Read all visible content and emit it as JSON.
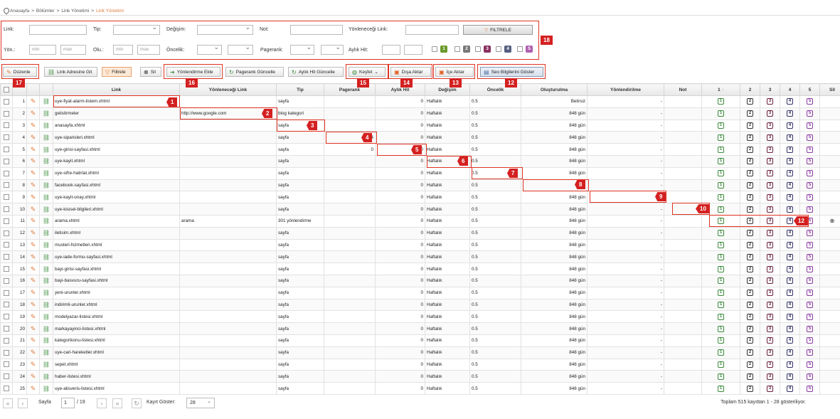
{
  "breadcrumb": {
    "items": [
      "Anasayfa",
      "Bölümler",
      "Link Yönetimi"
    ],
    "current": "Link Yönetimi",
    "separator": ">"
  },
  "filter": {
    "link_label": "Link:",
    "tip_label": "Tip:",
    "degisim_label": "Değişim:",
    "not_label": "Not:",
    "yonlenecegi_label": "Yönleneceği Link:",
    "filter_button": "FILTRELE",
    "yon_label": "Yön.:",
    "olu_label": "Olu.:",
    "oncelik_label": "Öncelik:",
    "pagerank_label": "Pagerank:",
    "aylik_label": "Aylık Hit:",
    "min_placeholder": "min",
    "max_placeholder": "max",
    "levels": [
      "1",
      "2",
      "3",
      "4",
      "5"
    ],
    "level_colors": [
      "#6a9a2a",
      "#777777",
      "#8a3060",
      "#556080",
      "#b060b0"
    ]
  },
  "toolbar": {
    "duzenle": "Düzenle",
    "link_adresine_git": "Link Adresine Git",
    "filtrele": "Filtrele",
    "sil": "Sil",
    "yonlendirme_ekle": "Yönlendirme Ekle",
    "pagerank_guncelle": "Pagerank Güncelle",
    "aylik_hit_guncelle": "Aylık Hit Güncelle",
    "kesfet": "Keşfet",
    "disa_aktar": "Dışa Aktar",
    "ice_aktar": "İçe Aktar",
    "seo_bilgileri": "Seo Bilgilerini Göster"
  },
  "annotations": [
    "1",
    "2",
    "3",
    "4",
    "5",
    "6",
    "7",
    "8",
    "9",
    "10",
    "11",
    "12",
    "13",
    "14",
    "15",
    "16",
    "17",
    "18"
  ],
  "table": {
    "headers": [
      "Link",
      "Yönleneceği Link",
      "Tip",
      "Pagerank",
      "Aylık Hit",
      "Değişim",
      "Öncelik",
      "Oluşturulma",
      "Yönlendirilme",
      "Not",
      "1",
      "2",
      "3",
      "4",
      "5",
      "Sil"
    ],
    "level_colors": [
      "#3a8a3a",
      "#333333",
      "#6a2040",
      "#333366",
      "#8a3aa0"
    ],
    "rows": [
      {
        "n": "1",
        "link": "uye-fiyat-alarm-listem.xhtml",
        "hedef": "",
        "tip": "sayfa",
        "pr": "",
        "hit": "0",
        "degisim": "Haftalık",
        "oncelik": "0.5",
        "olus": "Belirsiz",
        "yon": "-"
      },
      {
        "n": "2",
        "link": "gelistirmeler",
        "hedef": "http://www.google.com",
        "tip": "blog kategori",
        "pr": "",
        "hit": "0",
        "degisim": "Haftalık",
        "oncelik": "0.5",
        "olus": "848 gün",
        "yon": "-"
      },
      {
        "n": "3",
        "link": "anasayfa.xhtml",
        "hedef": "",
        "tip": "sayfa",
        "pr": "",
        "hit": "0",
        "degisim": "Haftalık",
        "oncelik": "0.5",
        "olus": "848 gün",
        "yon": "-"
      },
      {
        "n": "4",
        "link": "uye-siparisleri.xhtml",
        "hedef": "",
        "tip": "sayfa",
        "pr": "4",
        "hit": "0",
        "degisim": "Haftalık",
        "oncelik": "0.5",
        "olus": "848 gün",
        "yon": "-"
      },
      {
        "n": "5",
        "link": "uye-girisi-sayfasi.xhtml",
        "hedef": "",
        "tip": "sayfa",
        "pr": "0",
        "hit": "0",
        "degisim": "Haftalık",
        "oncelik": "0.5",
        "olus": "848 gün",
        "yon": "-"
      },
      {
        "n": "6",
        "link": "uye-kayit.xhtml",
        "hedef": "",
        "tip": "sayfa",
        "pr": "",
        "hit": "0",
        "degisim": "Haftalık",
        "oncelik": "0.5",
        "olus": "848 gün",
        "yon": "-"
      },
      {
        "n": "7",
        "link": "uye-sifre-hatirlat.xhtml",
        "hedef": "",
        "tip": "sayfa",
        "pr": "",
        "hit": "0",
        "degisim": "Haftalık",
        "oncelik": "0.5",
        "olus": "848 gün",
        "yon": "-"
      },
      {
        "n": "8",
        "link": "facebook-sayfasi.xhtml",
        "hedef": "",
        "tip": "sayfa",
        "pr": "",
        "hit": "0",
        "degisim": "Haftalık",
        "oncelik": "0.5",
        "olus": "848",
        "yon": "-"
      },
      {
        "n": "9",
        "link": "uye-kayit-onay.xhtml",
        "hedef": "",
        "tip": "sayfa",
        "pr": "",
        "hit": "0",
        "degisim": "Haftalık",
        "oncelik": "0.5",
        "olus": "848 gün",
        "yon": ""
      },
      {
        "n": "10",
        "link": "uye-kisisel-bilgileri.xhtml",
        "hedef": "",
        "tip": "sayfa",
        "pr": "",
        "hit": "0",
        "degisim": "Haftalık",
        "oncelik": "0.5",
        "olus": "848 gün",
        "yon": "-"
      },
      {
        "n": "11",
        "link": "arama.xhtml",
        "hedef": "arama",
        "tip": "301 yönlendirme",
        "pr": "",
        "hit": "0",
        "degisim": "Haftalık",
        "oncelik": "0.5",
        "olus": "848 gün",
        "yon": "-"
      },
      {
        "n": "12",
        "link": "iletisim.xhtml",
        "hedef": "",
        "tip": "sayfa",
        "pr": "",
        "hit": "0",
        "degisim": "Haftalık",
        "oncelik": "0.5",
        "olus": "848 gün",
        "yon": "-"
      },
      {
        "n": "13",
        "link": "musteri-hizmetleri.xhtml",
        "hedef": "",
        "tip": "sayfa",
        "pr": "",
        "hit": "0",
        "degisim": "Haftalık",
        "oncelik": "0.5",
        "olus": "848 gün",
        "yon": "-"
      },
      {
        "n": "14",
        "link": "uye-iade-formu-sayfasi.xhtml",
        "hedef": "",
        "tip": "sayfa",
        "pr": "",
        "hit": "0",
        "degisim": "Haftalık",
        "oncelik": "0.5",
        "olus": "848 gün",
        "yon": "-"
      },
      {
        "n": "15",
        "link": "bayi-girisi-sayfasi.xhtml",
        "hedef": "",
        "tip": "sayfa",
        "pr": "",
        "hit": "0",
        "degisim": "Haftalık",
        "oncelik": "0.5",
        "olus": "848 gün",
        "yon": "-"
      },
      {
        "n": "16",
        "link": "bayi-basvuru-sayfasi.xhtml",
        "hedef": "",
        "tip": "sayfa",
        "pr": "",
        "hit": "0",
        "degisim": "Haftalık",
        "oncelik": "0.5",
        "olus": "848 gün",
        "yon": "-"
      },
      {
        "n": "17",
        "link": "yeni-urunler.xhtml",
        "hedef": "",
        "tip": "sayfa",
        "pr": "",
        "hit": "0",
        "degisim": "Haftalık",
        "oncelik": "0.5",
        "olus": "848 gün",
        "yon": "-"
      },
      {
        "n": "18",
        "link": "indirimli-urunler.xhtml",
        "hedef": "",
        "tip": "sayfa",
        "pr": "",
        "hit": "0",
        "degisim": "Haftalık",
        "oncelik": "0.5",
        "olus": "848 gün",
        "yon": "-"
      },
      {
        "n": "19",
        "link": "modelyazar-listesi.xhtml",
        "hedef": "",
        "tip": "sayfa",
        "pr": "",
        "hit": "0",
        "degisim": "Haftalık",
        "oncelik": "0.5",
        "olus": "848 gün",
        "yon": "-"
      },
      {
        "n": "20",
        "link": "markayayinci-listesi.xhtml",
        "hedef": "",
        "tip": "sayfa",
        "pr": "",
        "hit": "0",
        "degisim": "Haftalık",
        "oncelik": "0.5",
        "olus": "848 gün",
        "yon": "-"
      },
      {
        "n": "21",
        "link": "kategorikonu-listesi.xhtml",
        "hedef": "",
        "tip": "sayfa",
        "pr": "",
        "hit": "0",
        "degisim": "Haftalık",
        "oncelik": "0.5",
        "olus": "848 gün",
        "yon": "-"
      },
      {
        "n": "22",
        "link": "uye-cari-hareketler.xhtml",
        "hedef": "",
        "tip": "sayfa",
        "pr": "",
        "hit": "0",
        "degisim": "Haftalık",
        "oncelik": "0.5",
        "olus": "848 gün",
        "yon": "-"
      },
      {
        "n": "23",
        "link": "sepet.xhtml",
        "hedef": "",
        "tip": "sayfa",
        "pr": "",
        "hit": "0",
        "degisim": "Haftalık",
        "oncelik": "0.5",
        "olus": "848 gün",
        "yon": "-"
      },
      {
        "n": "24",
        "link": "haber-listesi.xhtml",
        "hedef": "",
        "tip": "sayfa",
        "pr": "",
        "hit": "0",
        "degisim": "Haftalık",
        "oncelik": "0.5",
        "olus": "848 gün",
        "yon": "-"
      },
      {
        "n": "25",
        "link": "uye-alisveris-listesi.xhtml",
        "hedef": "",
        "tip": "sayfa",
        "pr": "",
        "hit": "0",
        "degisim": "Haftalık",
        "oncelik": "0.5",
        "olus": "848 gün",
        "yon": "-"
      }
    ]
  },
  "pager": {
    "sayfa_label": "Sayfa",
    "page": "1",
    "total_pages": "/ 19",
    "kayit_label": "Kayıt Göster:",
    "kayit_value": "28",
    "summary": "Toplam 515 kayıttan 1 - 28 gösteriliyor."
  }
}
